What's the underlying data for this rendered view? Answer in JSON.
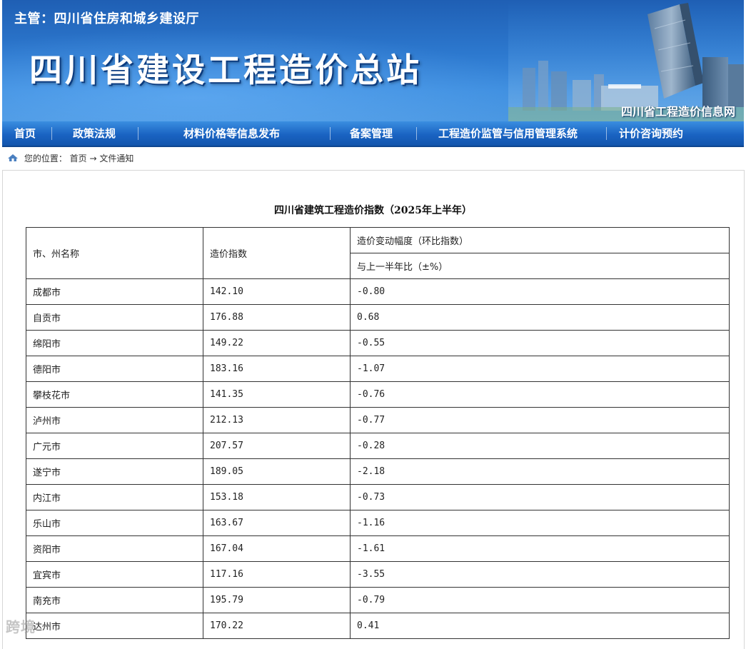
{
  "header": {
    "supervisor": "主管：四川省住房和城乡建设厅",
    "site_title": "四川省建设工程造价总站",
    "site_tag": "四川省工程造价信息网"
  },
  "nav": {
    "items": [
      {
        "label": "首页"
      },
      {
        "label": "政策法规"
      },
      {
        "label": "材料价格等信息发布"
      },
      {
        "label": "备案管理"
      },
      {
        "label": "工程造价监管与信用管理系统"
      },
      {
        "label": "计价咨询预约"
      }
    ]
  },
  "breadcrumb": {
    "prefix": "您的位置：",
    "home": "首页",
    "arrow": "→",
    "current": "文件通知"
  },
  "document": {
    "title": "四川省建筑工程造价指数（2025年上半年）",
    "table": {
      "col_city": "市、州名称",
      "col_index": "造价指数",
      "col_change_group": "造价变动幅度（环比指数）",
      "col_change_sub": "与上一半年比（±%）",
      "rows": [
        {
          "city": "成都市",
          "index": "142.10",
          "change": "-0.80"
        },
        {
          "city": "自贡市",
          "index": "176.88",
          "change": "0.68"
        },
        {
          "city": "绵阳市",
          "index": "149.22",
          "change": "-0.55"
        },
        {
          "city": "德阳市",
          "index": "183.16",
          "change": "-1.07"
        },
        {
          "city": "攀枝花市",
          "index": "141.35",
          "change": "-0.76"
        },
        {
          "city": "泸州市",
          "index": "212.13",
          "change": "-0.77"
        },
        {
          "city": "广元市",
          "index": "207.57",
          "change": "-0.28"
        },
        {
          "city": "遂宁市",
          "index": "189.05",
          "change": "-2.18"
        },
        {
          "city": "内江市",
          "index": "153.18",
          "change": "-0.73"
        },
        {
          "city": "乐山市",
          "index": "163.67",
          "change": "-1.16"
        },
        {
          "city": "资阳市",
          "index": "167.04",
          "change": "-1.61"
        },
        {
          "city": "宜宾市",
          "index": "117.16",
          "change": "-3.55"
        },
        {
          "city": "南充市",
          "index": "195.79",
          "change": "-0.79"
        },
        {
          "city": "达州市",
          "index": "170.22",
          "change": "0.41"
        }
      ]
    }
  },
  "watermark": "跨境",
  "colors": {
    "banner_blue": "#2d79cf",
    "nav_blue": "#1a63c2",
    "table_border": "#333333"
  }
}
